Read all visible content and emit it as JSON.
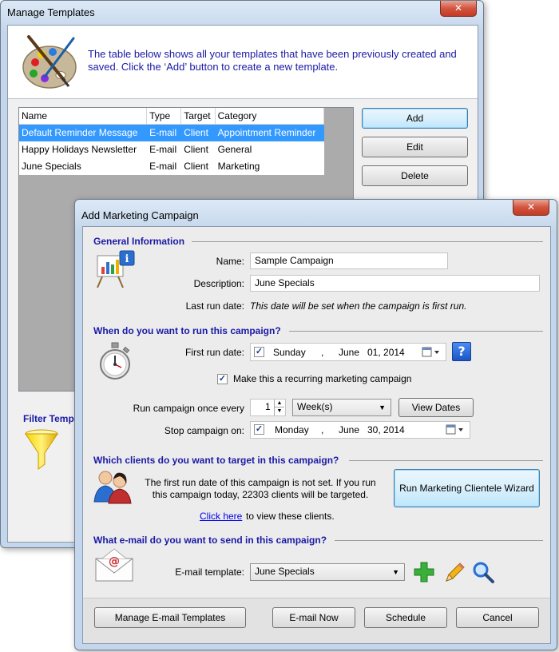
{
  "manage_templates": {
    "title": "Manage Templates",
    "close_glyph": "✕",
    "intro": "The table below shows all your templates that have been previously created and saved.  Click the ‘Add’ button to create a new template.",
    "columns": [
      "Name",
      "Type",
      "Target",
      "Category"
    ],
    "rows": [
      {
        "name": "Default Reminder Message",
        "type": "E-mail",
        "target": "Client",
        "category": "Appointment Reminder",
        "selected": true
      },
      {
        "name": "Happy Holidays Newsletter",
        "type": "E-mail",
        "target": "Client",
        "category": "General",
        "selected": false
      },
      {
        "name": "June Specials",
        "type": "E-mail",
        "target": "Client",
        "category": "Marketing",
        "selected": false
      }
    ],
    "add_label": "Add",
    "edit_label": "Edit",
    "delete_label": "Delete",
    "filter_label": "Filter Temp"
  },
  "campaign": {
    "title": "Add Marketing Campaign",
    "close_glyph": "✕",
    "general": {
      "heading": "General Information",
      "name_label": "Name:",
      "name_value": "Sample Campaign",
      "description_label": "Description:",
      "description_value": "June Specials",
      "last_run_label": "Last run date:",
      "last_run_value": "This date will be set when the campaign is first run."
    },
    "schedule": {
      "heading": "When do you want to run this campaign?",
      "first_run_label": "First run date:",
      "first_run": {
        "weekday": "Sunday",
        "sep": ",",
        "month": "June",
        "day_year": "01, 2014"
      },
      "recurring_label": "Make this a recurring marketing campaign",
      "run_every_label": "Run campaign once every",
      "run_every_value": "1",
      "period_value": "Week(s)",
      "view_dates_label": "View Dates",
      "stop_label": "Stop campaign on:",
      "stop": {
        "weekday": "Monday",
        "sep": ",",
        "month": "June",
        "day_year": "30, 2014"
      },
      "help_glyph": "?"
    },
    "clients": {
      "heading": "Which clients do you want to target in this campaign?",
      "message": "The first run date of this campaign is not set.  If you run this campaign today, 22303 clients will be targeted.",
      "link_label": "Click here",
      "link_suffix": "to view these clients.",
      "wizard_label": "Run Marketing Clientele Wizard"
    },
    "email": {
      "heading": "What e-mail do you want to send in this campaign?",
      "template_label": "E-mail template:",
      "template_value": "June Specials"
    },
    "footer": {
      "manage_label": "Manage E-mail Templates",
      "email_now_label": "E-mail Now",
      "schedule_label": "Schedule",
      "cancel_label": "Cancel"
    }
  }
}
